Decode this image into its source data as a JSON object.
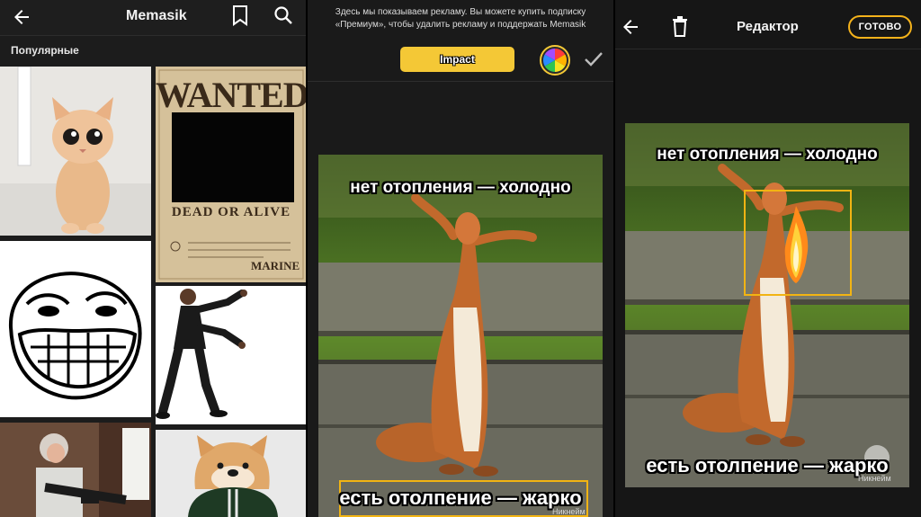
{
  "list_screen": {
    "app_title": "Memasik",
    "section_label": "Популярные",
    "poster": {
      "top_text": "WANTED",
      "middle_text": "DEAD OR ALIVE",
      "bottom_text": "MARINE"
    },
    "icons": [
      "back-arrow-icon",
      "bookmark-icon",
      "search-icon"
    ]
  },
  "text_style_screen": {
    "ad_notice": "Здесь мы показываем рекламу. Вы можете купить подписку «Премиум», чтобы удалить рекламу и поддержать Memasik",
    "font_button_label": "Impact",
    "top_caption": "нет отопления — холодно",
    "bottom_caption": "есть отолпение — жарко",
    "watermark": "Никнейм",
    "icons": [
      "color-wheel-icon",
      "checkmark-icon"
    ],
    "accent_color": "#f4c836"
  },
  "editor_screen": {
    "title": "Редактор",
    "done_label": "ГОТОВО",
    "top_caption": "нет отопления — холодно",
    "bottom_caption": "есть отолпение — жарко",
    "watermark": "Никнейм",
    "icons": [
      "back-arrow-icon",
      "trash-icon",
      "fire-sticker-icon"
    ],
    "accent_color": "#f2b413"
  }
}
